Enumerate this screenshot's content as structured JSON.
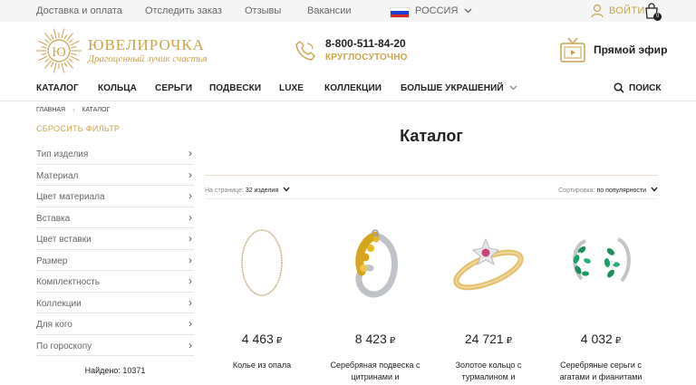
{
  "topbar": {
    "links": [
      "Доставка и оплата",
      "Отследить заказ",
      "Отзывы",
      "Вакансии"
    ],
    "region": "РОССИЯ",
    "login": "ВОЙТИ",
    "cart_count": "0",
    "flag_colors": [
      "#ffffff",
      "#1c3fd6",
      "#d52b1e"
    ]
  },
  "header": {
    "logo_mark": "Ю",
    "logo_name": "ЮВЕЛИРОЧКА",
    "logo_tagline": "Драгоценный лучик счастья",
    "phone": "8-800-511-84-20",
    "phone_note": "КРУГЛОСУТОЧНО",
    "live": "Прямой эфир",
    "accent_color": "#c9a44a"
  },
  "nav": {
    "items": [
      "КАТАЛОГ",
      "КОЛЬЦА",
      "СЕРЬГИ",
      "ПОДВЕСКИ",
      "LUXE",
      "КОЛЛЕКЦИИ",
      "БОЛЬШЕ УКРАШЕНИЙ"
    ],
    "search": "ПОИСК"
  },
  "breadcrumb": [
    "ГЛАВНАЯ",
    "КАТАЛОГ"
  ],
  "sidebar": {
    "reset": "СБРОСИТЬ ФИЛЬТР",
    "filters": [
      "Тип изделия",
      "Материал",
      "Цвет материала",
      "Вставка",
      "Цвет вставки",
      "Размер",
      "Комплектность",
      "Коллекции",
      "Для кого",
      "По гороскопу"
    ],
    "found": "Найдено: 10371"
  },
  "main": {
    "title": "Каталог",
    "per_page_label": "На странице:",
    "per_page_value": "32 изделия",
    "sort_label": "Сортировка:",
    "sort_value": "по популярности",
    "products": [
      {
        "price": "4 463",
        "currency": "₽",
        "name": "Колье из опала"
      },
      {
        "price": "8 423",
        "currency": "₽",
        "name": "Серебряная подвеска с цитринами и"
      },
      {
        "price": "24 721",
        "currency": "₽",
        "name": "Золотое кольцо с турмалином и"
      },
      {
        "price": "4 032",
        "currency": "₽",
        "name": "Серебряные серьги с агатами и фианитами"
      }
    ]
  }
}
